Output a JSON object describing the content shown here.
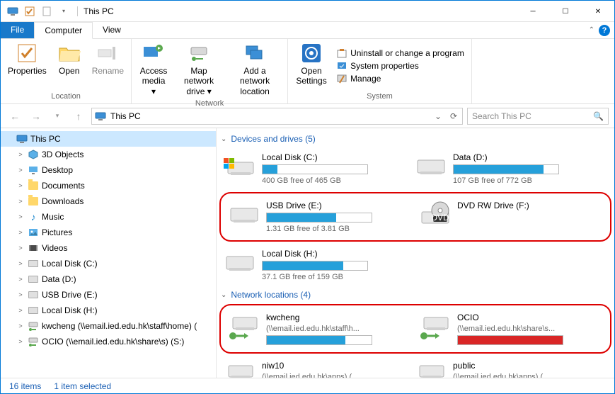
{
  "title": "This PC",
  "tabs": {
    "file": "File",
    "computer": "Computer",
    "view": "View"
  },
  "ribbon": {
    "location": {
      "label": "Location",
      "properties": "Properties",
      "open": "Open",
      "rename": "Rename"
    },
    "network": {
      "label": "Network",
      "access": "Access media",
      "map": "Map network drive",
      "add": "Add a network location"
    },
    "open_settings": "Open Settings",
    "system": {
      "label": "System",
      "uninstall": "Uninstall or change a program",
      "props": "System properties",
      "manage": "Manage"
    }
  },
  "address": "This PC",
  "search_placeholder": "Search This PC",
  "tree": [
    {
      "label": "This PC",
      "icon": "pc",
      "sel": true,
      "indent": 0,
      "exp": ""
    },
    {
      "label": "3D Objects",
      "icon": "3d",
      "indent": 1,
      "exp": ">"
    },
    {
      "label": "Desktop",
      "icon": "desktop",
      "indent": 1,
      "exp": ">"
    },
    {
      "label": "Documents",
      "icon": "folder",
      "indent": 1,
      "exp": ">"
    },
    {
      "label": "Downloads",
      "icon": "folder",
      "indent": 1,
      "exp": ">"
    },
    {
      "label": "Music",
      "icon": "music",
      "indent": 1,
      "exp": ">"
    },
    {
      "label": "Pictures",
      "icon": "pic",
      "indent": 1,
      "exp": ">"
    },
    {
      "label": "Videos",
      "icon": "video",
      "indent": 1,
      "exp": ">"
    },
    {
      "label": "Local Disk (C:)",
      "icon": "drive",
      "indent": 1,
      "exp": ">"
    },
    {
      "label": "Data (D:)",
      "icon": "drive",
      "indent": 1,
      "exp": ">"
    },
    {
      "label": "USB Drive (E:)",
      "icon": "drive",
      "indent": 1,
      "exp": ">"
    },
    {
      "label": "Local Disk (H:)",
      "icon": "drive",
      "indent": 1,
      "exp": ">"
    },
    {
      "label": "kwcheng (\\\\email.ied.edu.hk\\staff\\home) (",
      "icon": "net",
      "indent": 1,
      "exp": ">"
    },
    {
      "label": "OCIO (\\\\email.ied.edu.hk\\share\\s) (S:)",
      "icon": "net",
      "indent": 1,
      "exp": ">"
    }
  ],
  "sections": {
    "devices": {
      "title": "Devices and drives (5)"
    },
    "network": {
      "title": "Network locations (4)"
    }
  },
  "drives1": [
    {
      "name": "Local Disk (C:)",
      "free": "400 GB free of 465 GB",
      "fill": 14,
      "icon": "win"
    },
    {
      "name": "Data (D:)",
      "free": "107 GB free of 772 GB",
      "fill": 86,
      "icon": "hdd"
    }
  ],
  "drives2": [
    {
      "name": "USB Drive (E:)",
      "free": "1.31 GB free of 3.81 GB",
      "fill": 66,
      "icon": "hdd"
    },
    {
      "name": "DVD RW Drive (F:)",
      "free": "",
      "fill": null,
      "icon": "dvd"
    }
  ],
  "drives3": [
    {
      "name": "Local Disk (H:)",
      "free": "37.1 GB free of 159 GB",
      "fill": 77,
      "icon": "hdd"
    }
  ],
  "net1": [
    {
      "name": "kwcheng",
      "sub": "(\\\\email.ied.edu.hk\\staff\\h...",
      "fill": 75,
      "icon": "net",
      "red": false
    },
    {
      "name": "OCIO",
      "sub": "(\\\\email.ied.edu.hk\\share\\s...",
      "fill": 100,
      "icon": "net",
      "red": true
    }
  ],
  "net2": [
    {
      "name": "niw10",
      "sub": "(\\\\email.ied.edu.hk\\apps) (...",
      "fill": null,
      "icon": "net"
    },
    {
      "name": "public",
      "sub": "(\\\\email.ied.edu.hk\\apps) (...",
      "fill": null,
      "icon": "net"
    }
  ],
  "status": {
    "items": "16 items",
    "selected": "1 item selected"
  }
}
